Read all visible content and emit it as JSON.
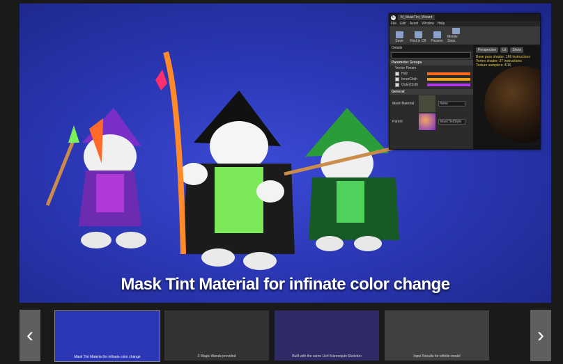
{
  "main": {
    "caption": "Mask Tint Material for infinate color change"
  },
  "editor": {
    "title_tab": "M_MaskTint_Wizard",
    "menu": [
      "File",
      "Edit",
      "Asset",
      "Window",
      "Help"
    ],
    "toolbar": [
      "Save",
      "Find in CB",
      "Params",
      "Mobile Stats"
    ],
    "details_tab": "Details",
    "param_groups": "Parameter Groups",
    "vector_param": "Vector Param",
    "vectors": [
      {
        "name": "Hair",
        "color": "#ff6a1a"
      },
      {
        "name": "InnerCloth",
        "color": "#f2a020"
      },
      {
        "name": "OuterCloth",
        "color": "#b23be8"
      }
    ],
    "general": "General",
    "mask_material_label": "Mask Material",
    "mask_material_value": "None",
    "parent_label": "Parent",
    "parent_value": "MaskTintStyle",
    "viewport": {
      "perspective": "Perspective",
      "lit": "Lit",
      "show": "Show",
      "stats": [
        "Base pass shader: 166 instructions",
        "Vertex shader: 37 instructions",
        "Texture samplers: 4/16"
      ]
    }
  },
  "thumbnails": [
    {
      "caption": "Mask Tint Material for infinate color change"
    },
    {
      "caption": "2 Magic Wands provided"
    },
    {
      "caption": "Built with the same Ue4 Mannequin Skeleton"
    },
    {
      "caption": "Input Results for infinite model"
    }
  ],
  "nav": {
    "prev": "‹",
    "next": "›"
  }
}
